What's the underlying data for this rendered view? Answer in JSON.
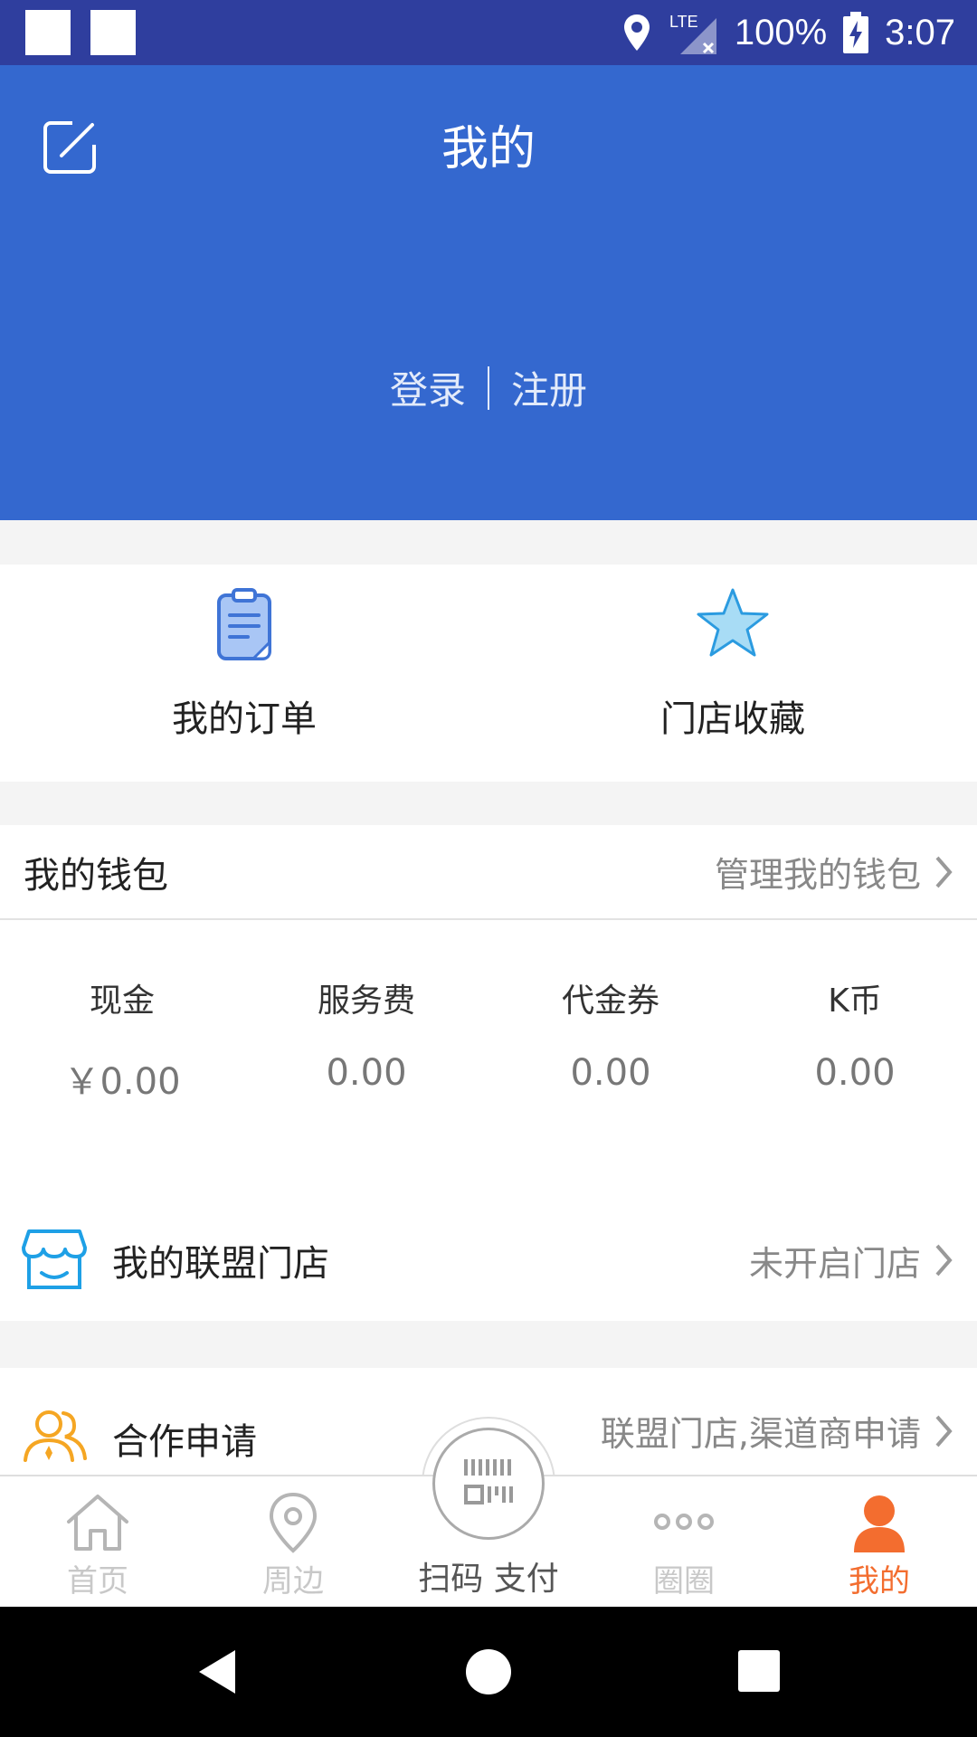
{
  "status_bar": {
    "network": "LTE",
    "battery": "100%",
    "time": "3:07"
  },
  "header": {
    "title": "我的",
    "login": "登录",
    "register": "注册"
  },
  "quick_actions": [
    {
      "label": "我的订单",
      "icon": "clipboard-icon"
    },
    {
      "label": "门店收藏",
      "icon": "star-icon"
    }
  ],
  "wallet": {
    "title": "我的钱包",
    "manage": "管理我的钱包",
    "balances": [
      {
        "label": "现金",
        "value": "￥0.00"
      },
      {
        "label": "服务费",
        "value": "0.00"
      },
      {
        "label": "代金券",
        "value": "0.00"
      },
      {
        "label": "K币",
        "value": "0.00"
      }
    ]
  },
  "store": {
    "label": "我的联盟门店",
    "status": "未开启门店"
  },
  "cooperation": {
    "label": "合作申请",
    "detail": "联盟门店,渠道商申请"
  },
  "bottom_nav": {
    "items": [
      {
        "label": "首页",
        "icon": "home-icon"
      },
      {
        "label": "周边",
        "icon": "location-pin-icon"
      },
      {
        "label": "扫码 支付",
        "icon": "scan-pay-icon"
      },
      {
        "label": "圈圈",
        "icon": "dots-icon"
      },
      {
        "label": "我的",
        "icon": "person-icon"
      }
    ],
    "active": "我的"
  },
  "colors": {
    "header": "#3468cf",
    "status_bar": "#2f3e9e",
    "active": "#f36d2f",
    "store_icon": "#1ea0e6",
    "coop_icon": "#f5a623"
  }
}
